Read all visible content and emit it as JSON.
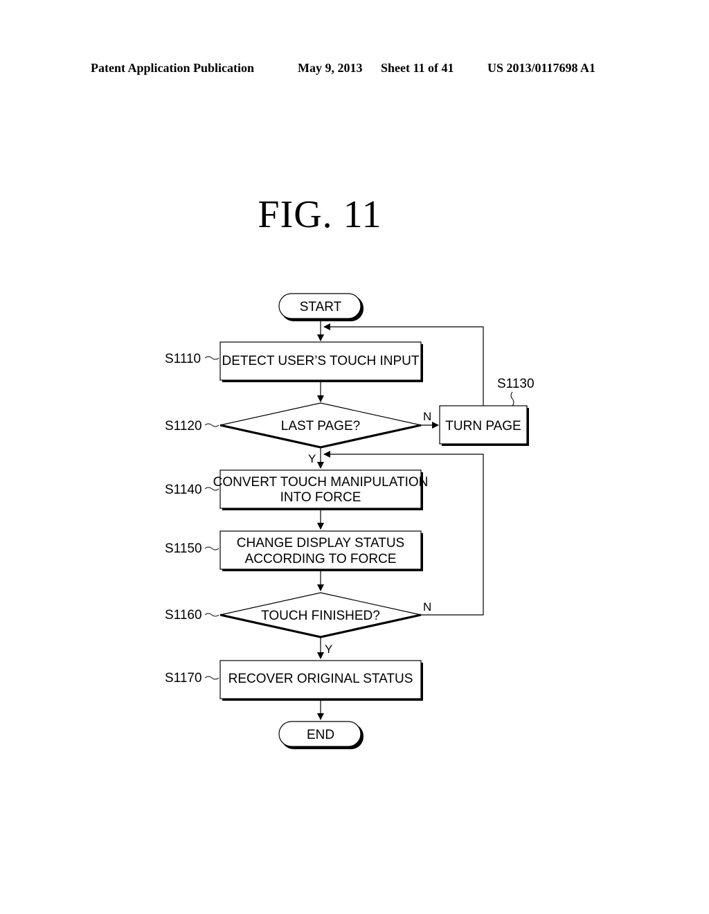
{
  "header": {
    "publication": "Patent Application Publication",
    "date": "May 9, 2013",
    "sheet": "Sheet 11 of 41",
    "number": "US 2013/0117698 A1"
  },
  "figure": {
    "title": "FIG.  11"
  },
  "flowchart": {
    "start": "START",
    "end": "END",
    "steps": {
      "s1110": {
        "id": "S1110",
        "text": "DETECT USER’S TOUCH INPUT"
      },
      "s1120": {
        "id": "S1120",
        "text": "LAST PAGE?"
      },
      "s1130": {
        "id": "S1130",
        "text": "TURN PAGE"
      },
      "s1140": {
        "id": "S1140",
        "line1": "CONVERT TOUCH MANIPULATION",
        "line2": "INTO FORCE"
      },
      "s1150": {
        "id": "S1150",
        "line1": "CHANGE DISPLAY STATUS",
        "line2": "ACCORDING TO FORCE"
      },
      "s1160": {
        "id": "S1160",
        "text": "TOUCH FINISHED?"
      },
      "s1170": {
        "id": "S1170",
        "text": "RECOVER ORIGINAL STATUS"
      }
    },
    "branch_labels": {
      "yes": "Y",
      "no": "N"
    }
  }
}
